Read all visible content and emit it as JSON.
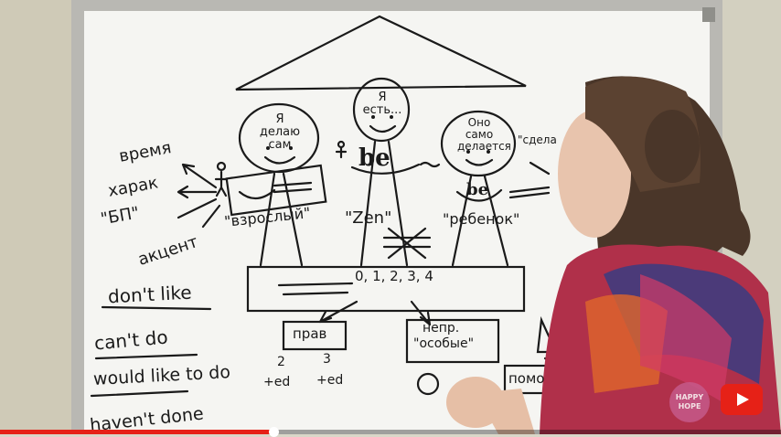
{
  "board": {
    "hat_labels": [
      "Я делаю сам",
      "Я есть...",
      "Оно само делается",
      "\"сдела"
    ],
    "center_word": "be",
    "right_word": "be",
    "roles": [
      "\"взрослый\"",
      "\"Zen\"",
      "\"ребенок\""
    ],
    "left_list": [
      "время",
      "харак",
      "\"БП\"",
      "акцент"
    ],
    "scale_numbers": "0, 1, 2, 3, 4",
    "box_left": "прав",
    "box_right_line1": "непр.",
    "box_right_line2": "\"особые\"",
    "phrases": [
      "don't like",
      "can't do",
      "would like to do",
      "haven't done"
    ],
    "forms": [
      "2",
      "3",
      "+ed",
      "+ed"
    ],
    "help_word": "помо"
  },
  "player": {
    "logo_text": "HAPPY HOPE",
    "progress": 0.35
  },
  "colors": {
    "ink": "#1a1a1a",
    "board": "#f4f4f1",
    "frame": "#b8b8b4",
    "youtube_red": "#e62117"
  }
}
